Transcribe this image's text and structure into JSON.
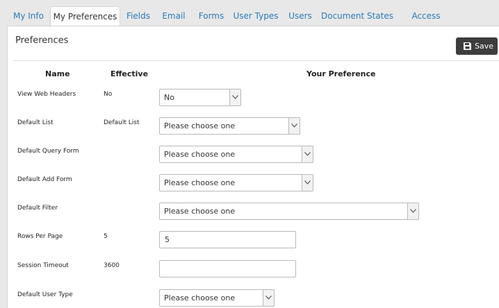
{
  "tabs": [
    {
      "label": "My Info",
      "active": false
    },
    {
      "label": "My Preferences",
      "active": true
    },
    {
      "label": "Fields",
      "active": false
    },
    {
      "label": "Email",
      "active": false
    },
    {
      "label": "Forms",
      "active": false
    },
    {
      "label": "User Types",
      "active": false
    },
    {
      "label": "Users",
      "active": false
    },
    {
      "label": "Document States",
      "active": false
    },
    {
      "label": "Access Levels",
      "active": false
    }
  ],
  "panel": {
    "title": "Preferences",
    "save_label": "Save"
  },
  "table": {
    "headers": {
      "name": "Name",
      "effective": "Effective",
      "preference": "Your Preference"
    },
    "rows": [
      {
        "name": "View Web Headers",
        "effective": "No",
        "control": "select",
        "value": "No"
      },
      {
        "name": "Default List",
        "effective": "Default List",
        "control": "select",
        "value": "Please choose one"
      },
      {
        "name": "Default Query Form",
        "effective": "",
        "control": "select",
        "value": "Please choose one"
      },
      {
        "name": "Default Add Form",
        "effective": "",
        "control": "select",
        "value": "Please choose one"
      },
      {
        "name": "Default Filter",
        "effective": "",
        "control": "select",
        "value": "Please choose one"
      },
      {
        "name": "Rows Per Page",
        "effective": "5",
        "control": "input",
        "value": "5"
      },
      {
        "name": "Session Timeout",
        "effective": "3600",
        "control": "input",
        "value": ""
      },
      {
        "name": "Default User Type",
        "effective": "",
        "control": "select",
        "value": "Please choose one"
      }
    ]
  },
  "icons": {
    "save": "floppy-disk-icon",
    "dropdown": "chevron-down-icon"
  },
  "colors": {
    "tab_link": "#2a7ab8",
    "save_button": "#3d3d3d",
    "background": "#e8e8e8"
  }
}
